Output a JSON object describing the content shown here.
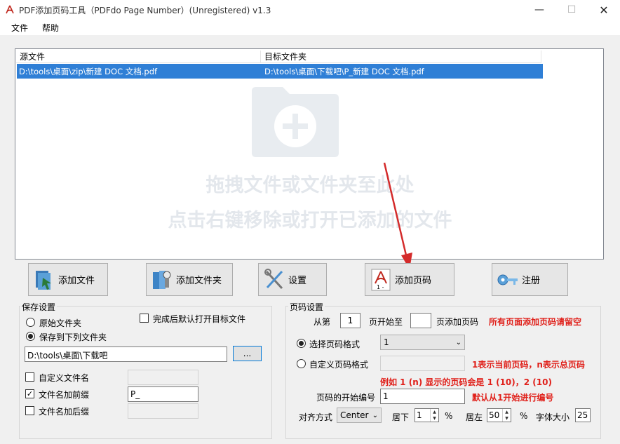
{
  "window": {
    "title": "PDF添加页码工具（PDFdo Page Number）(Unregistered) v1.3",
    "min": "—",
    "max": "☐",
    "close": "✕"
  },
  "menu": {
    "file": "文件",
    "help": "帮助"
  },
  "file_list": {
    "col_source": "源文件",
    "col_target": "目标文件夹",
    "rows": [
      {
        "source": "D:\\tools\\桌面\\zip\\新建 DOC 文档.pdf",
        "target": "D:\\tools\\桌面\\下载吧\\P_新建 DOC 文档.pdf"
      }
    ],
    "hint_line1": "拖拽文件或文件夹至此处",
    "hint_line2": "点击右键移除或打开已添加的文件"
  },
  "toolbar": {
    "add_file": "添加文件",
    "add_folder": "添加文件夹",
    "settings": "设置",
    "add_page_number": "添加页码",
    "register": "注册"
  },
  "save_settings": {
    "title": "保存设置",
    "original_folder": "原始文件夹",
    "save_to_folder": "保存到下列文件夹",
    "open_after": "完成后默认打开目标文件",
    "folder_path": "D:\\tools\\桌面\\下载吧",
    "browse": "...",
    "custom_filename": "自定义文件名",
    "prefix": "文件名加前缀",
    "prefix_value": "P_",
    "suffix": "文件名加后缀",
    "selected": "save_to_folder",
    "prefix_checked": true
  },
  "page_settings": {
    "title": "页码设置",
    "from_label": "从第",
    "from_value": "1",
    "to_label": "页开始至",
    "to_value": "",
    "add_label": "页添加页码",
    "all_pages_hint": "所有页面添加页码请留空",
    "select_format": "选择页码格式",
    "format_value": "1",
    "custom_format": "自定义页码格式",
    "format_hint1": "1表示当前页码，n表示总页码",
    "format_hint2": "例如 1 (n) 显示的页码会是 1 (10)，2 (10)",
    "start_number_label": "页码的开始编号",
    "start_number_value": "1",
    "start_hint": "默认从1开始进行编号",
    "align_label": "对齐方式",
    "align_value": "Center",
    "bottom_label": "居下",
    "bottom_value": "1",
    "percent1": "%",
    "left_label": "居左",
    "left_value": "50",
    "percent2": "%",
    "font_size_label": "字体大小",
    "font_size_value": "25"
  },
  "colors": {
    "selection": "#2f7fd6",
    "hint_red": "#e0201a",
    "arrow": "#d42b2b"
  }
}
